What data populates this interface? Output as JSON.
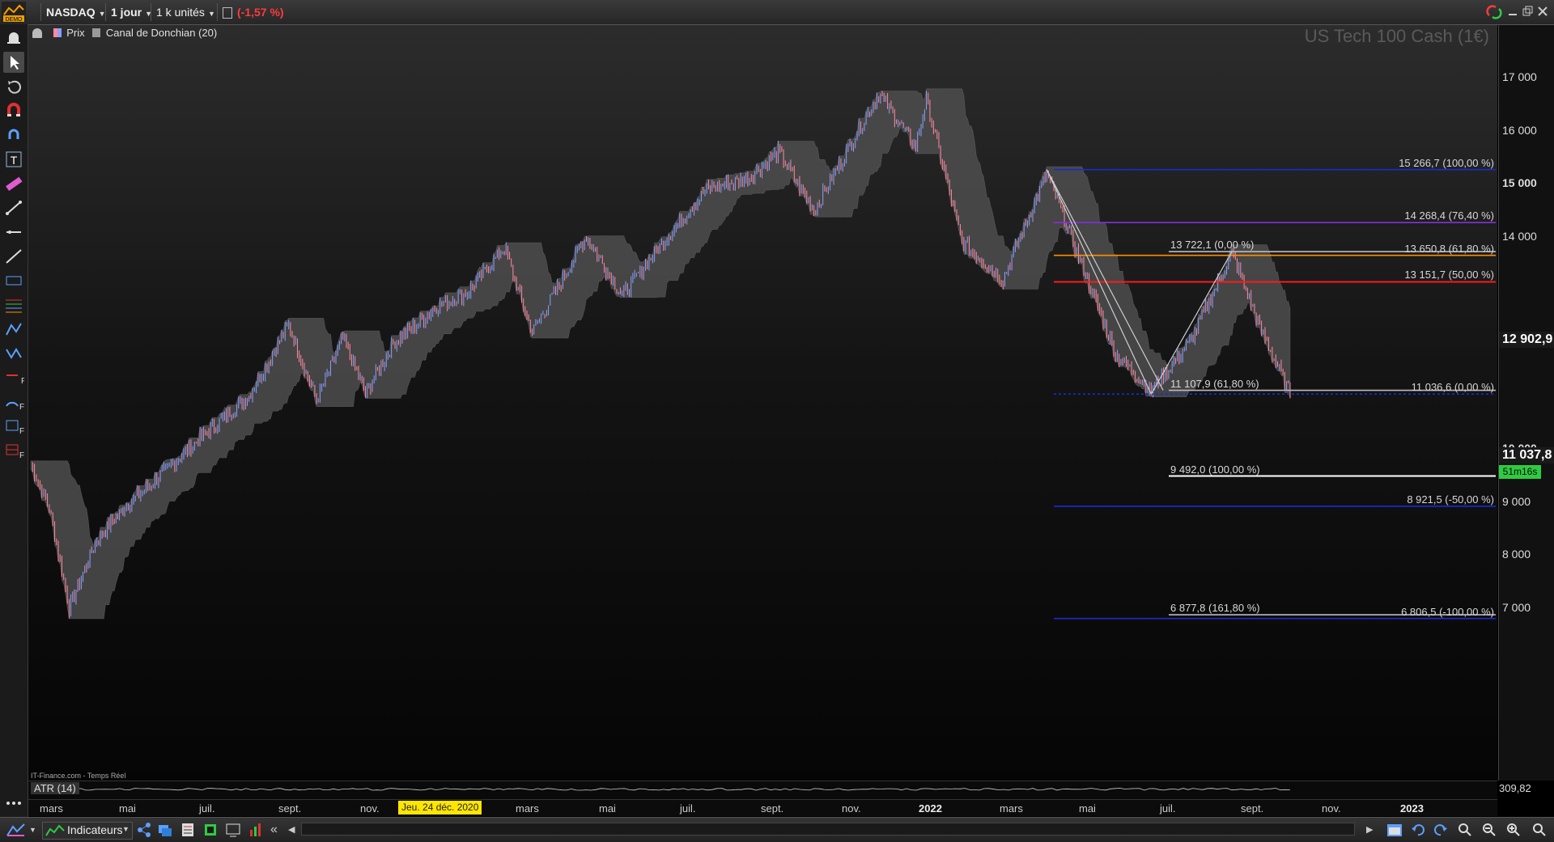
{
  "topbar": {
    "logo_text": "DEMO",
    "instrument": "NASDAQ",
    "period": "1 jour",
    "units": "1 k unités",
    "change": "(-1,57 %)",
    "change_color": "#ff3b3b"
  },
  "legend": {
    "price_label": "Prix",
    "donchian_label": "Canal de Donchian (20)"
  },
  "watermark": "US Tech 100 Cash (1€)",
  "source": "IT-Finance.com - Temps Réel",
  "price_axis": [
    {
      "label": "17 000",
      "value": 17000,
      "bold": false
    },
    {
      "label": "16 000",
      "value": 16000,
      "bold": false
    },
    {
      "label": "15 000",
      "value": 15000,
      "bold": true
    },
    {
      "label": "14 000",
      "value": 14000,
      "bold": false
    },
    {
      "label": "12 000",
      "value": 12000,
      "bold": false
    },
    {
      "label": "10 000",
      "value": 10000,
      "bold": true
    },
    {
      "label": "9 000",
      "value": 9000,
      "bold": false
    },
    {
      "label": "8 000",
      "value": 8000,
      "bold": false
    },
    {
      "label": "7 000",
      "value": 7000,
      "bold": false
    }
  ],
  "price_tags": {
    "upper": "12 902,9",
    "last": "11 037,8",
    "timer": "51m16s"
  },
  "fib_levels": [
    {
      "label": "15 266,7 (100,00 %)",
      "value": 15266.7,
      "color": "#1a2bd0"
    },
    {
      "label": "14 268,4 (76,40 %)",
      "value": 14268.4,
      "color": "#8a2be2"
    },
    {
      "label": "13 722,1 (0,00 %)",
      "value": 13722.1,
      "color": "#bbbbbb"
    },
    {
      "label": "13 650,8 (61,80 %)",
      "value": 13650.8,
      "color": "#ff8c00"
    },
    {
      "label": "13 151,7 (50,00 %)",
      "value": 13151.7,
      "color": "#ff1a1a"
    },
    {
      "label": "11 107,9 (61,80 %)",
      "value": 11107.9,
      "color": "#bbbbbb"
    },
    {
      "label": "11 036,6 (0,00 %)",
      "value": 11036.6,
      "color": "#1a2bd0"
    },
    {
      "label": "9 492,0 (100,00 %)",
      "value": 9492.0,
      "color": "#ffffff"
    },
    {
      "label": "8 921,5 (-50,00 %)",
      "value": 8921.5,
      "color": "#1a2bd0"
    },
    {
      "label": "6 877,8 (161,80 %)",
      "value": 6877.8,
      "color": "#bbbbbb"
    },
    {
      "label": "6 806,5 (-100,00 %)",
      "value": 6806.5,
      "color": "#1a2bd0"
    }
  ],
  "indicator": {
    "label": "ATR (14)",
    "value": "309,82"
  },
  "time_axis": [
    {
      "label": "mars",
      "year": false
    },
    {
      "label": "mai",
      "year": false
    },
    {
      "label": "juil.",
      "year": false
    },
    {
      "label": "sept.",
      "year": false
    },
    {
      "label": "nov.",
      "year": false
    },
    {
      "label": "mars",
      "year": false
    },
    {
      "label": "mai",
      "year": false
    },
    {
      "label": "juil.",
      "year": false
    },
    {
      "label": "sept.",
      "year": false
    },
    {
      "label": "nov.",
      "year": false
    },
    {
      "label": "2022",
      "year": true
    },
    {
      "label": "mars",
      "year": false
    },
    {
      "label": "mai",
      "year": false
    },
    {
      "label": "juil.",
      "year": false
    },
    {
      "label": "sept.",
      "year": false
    },
    {
      "label": "nov.",
      "year": false
    },
    {
      "label": "2023",
      "year": true
    }
  ],
  "crosshair_date": "Jeu. 24 déc. 2020",
  "bottombar": {
    "indicators_label": "Indicateurs"
  },
  "chart_data": {
    "type": "line",
    "title": "US Tech 100 Cash (1€)",
    "series": [
      {
        "name": "Prix",
        "points": [
          [
            "2020-02-20",
            9700
          ],
          [
            "2020-03-05",
            8900
          ],
          [
            "2020-03-20",
            7000
          ],
          [
            "2020-04-10",
            8300
          ],
          [
            "2020-05-01",
            8900
          ],
          [
            "2020-06-01",
            9600
          ],
          [
            "2020-07-01",
            10300
          ],
          [
            "2020-08-03",
            11000
          ],
          [
            "2020-09-02",
            12350
          ],
          [
            "2020-09-23",
            10900
          ],
          [
            "2020-10-13",
            12100
          ],
          [
            "2020-10-30",
            11050
          ],
          [
            "2020-11-20",
            12000
          ],
          [
            "2020-12-24",
            12700
          ],
          [
            "2021-01-15",
            12950
          ],
          [
            "2021-02-12",
            13800
          ],
          [
            "2021-03-05",
            12200
          ],
          [
            "2021-04-15",
            14000
          ],
          [
            "2021-05-12",
            12900
          ],
          [
            "2021-06-15",
            14000
          ],
          [
            "2021-07-15",
            14900
          ],
          [
            "2021-08-15",
            15100
          ],
          [
            "2021-09-07",
            15600
          ],
          [
            "2021-10-04",
            14500
          ],
          [
            "2021-11-22",
            16700
          ],
          [
            "2021-12-20",
            15700
          ],
          [
            "2021-12-28",
            16600
          ],
          [
            "2022-01-24",
            13900
          ],
          [
            "2022-02-24",
            13200
          ],
          [
            "2022-03-29",
            15200
          ],
          [
            "2022-05-20",
            11800
          ],
          [
            "2022-06-16",
            11100
          ],
          [
            "2022-07-15",
            12000
          ],
          [
            "2022-08-16",
            13700
          ],
          [
            "2022-09-06",
            12300
          ],
          [
            "2022-09-29",
            11040
          ]
        ]
      }
    ],
    "indicator_series": [
      {
        "name": "Canal de Donchian (20)"
      },
      {
        "name": "ATR (14)"
      }
    ],
    "ylim": [
      6600,
      17300
    ],
    "last_value": 11037.8,
    "grid": false
  }
}
